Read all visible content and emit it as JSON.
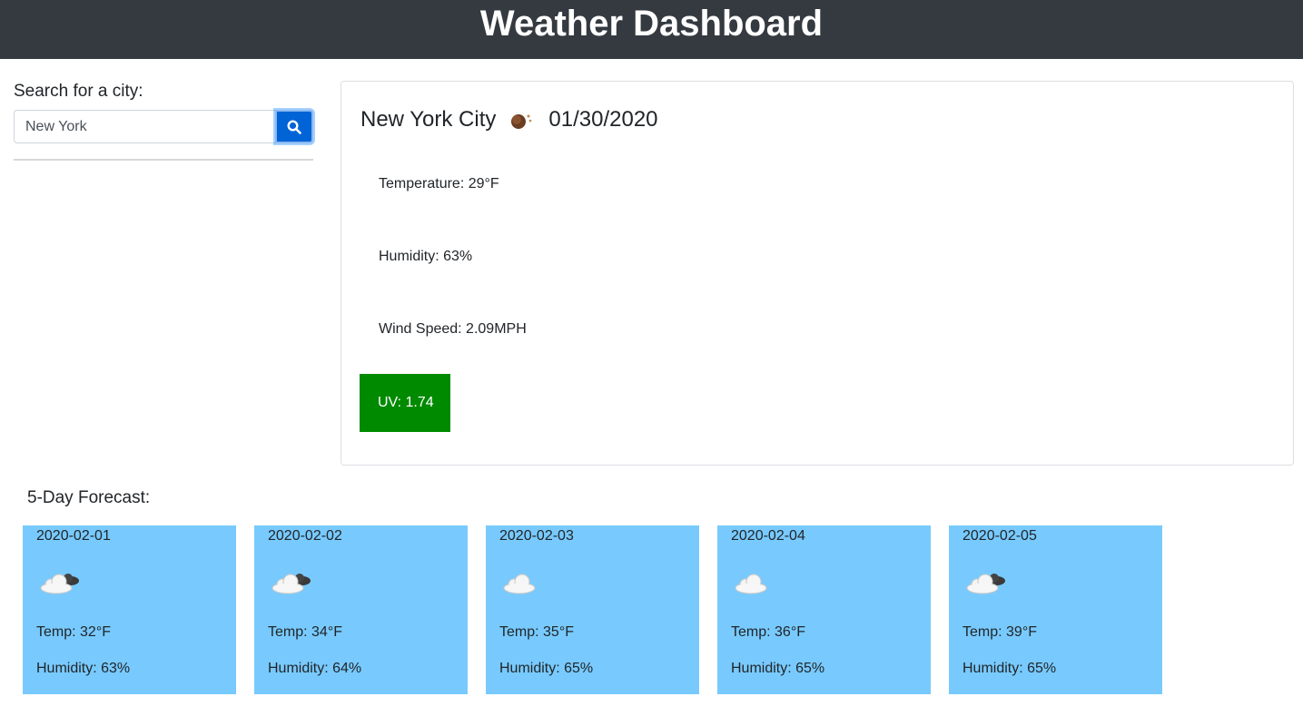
{
  "header": {
    "title": "Weather Dashboard"
  },
  "search": {
    "label": "Search for a city:",
    "value": "New York",
    "button_icon": "search-icon"
  },
  "current": {
    "city": "New York City",
    "icon": "rain-cloud-icon",
    "date": "01/30/2020",
    "temperature": "Temperature: 29°F",
    "humidity": "Humidity: 63%",
    "wind": "Wind Speed: 2.09MPH",
    "uv": "UV: 1.74",
    "uv_color": "#008a00"
  },
  "forecast": {
    "title": "5-Day Forecast:",
    "card_color": "#78cafe",
    "days": [
      {
        "date": "2020-02-01",
        "icon": "partly-cloudy-icon",
        "temp": "Temp: 32°F",
        "humidity": "Humidity: 63%"
      },
      {
        "date": "2020-02-02",
        "icon": "partly-cloudy-icon",
        "temp": "Temp: 34°F",
        "humidity": "Humidity: 64%"
      },
      {
        "date": "2020-02-03",
        "icon": "cloud-icon",
        "temp": "Temp: 35°F",
        "humidity": "Humidity: 65%"
      },
      {
        "date": "2020-02-04",
        "icon": "cloud-icon",
        "temp": "Temp: 36°F",
        "humidity": "Humidity: 65%"
      },
      {
        "date": "2020-02-05",
        "icon": "partly-cloudy-icon",
        "temp": "Temp: 39°F",
        "humidity": "Humidity: 65%"
      }
    ]
  }
}
